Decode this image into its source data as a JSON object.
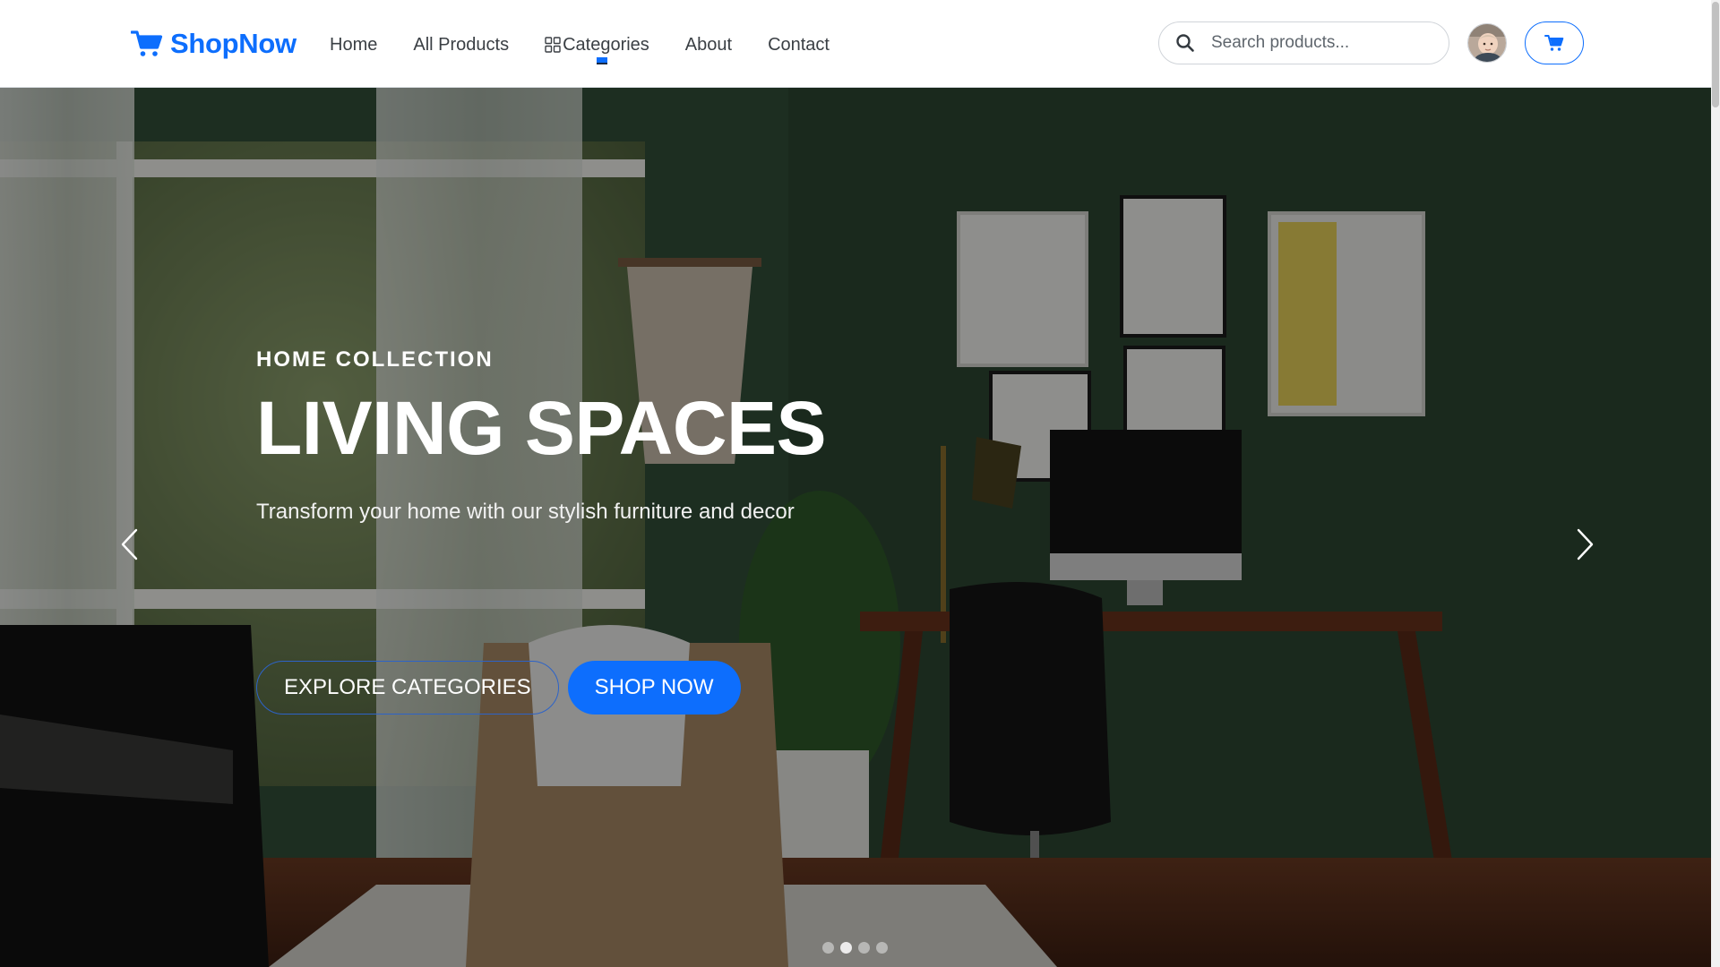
{
  "brand": {
    "name": "ShopNow",
    "icon": "cart-icon",
    "color": "#0d6efd"
  },
  "nav": {
    "home": "Home",
    "all_products": "All Products",
    "categories": "Categories",
    "about": "About",
    "contact": "Contact"
  },
  "search": {
    "placeholder": "Search products...",
    "value": ""
  },
  "user": {
    "avatar_icon": "user-avatar"
  },
  "cart": {
    "icon": "cart-icon"
  },
  "hero": {
    "eyebrow": "HOME COLLECTION",
    "headline": "LIVING SPACES",
    "subtitle": "Transform your home with our stylish furniture and decor",
    "explore_label": "EXPLORE CATEGORIES",
    "shop_label": "SHOP NOW",
    "slide_count": 4,
    "active_slide": 2
  },
  "colors": {
    "accent": "#0d6efd",
    "wall": "#2f4a34"
  }
}
